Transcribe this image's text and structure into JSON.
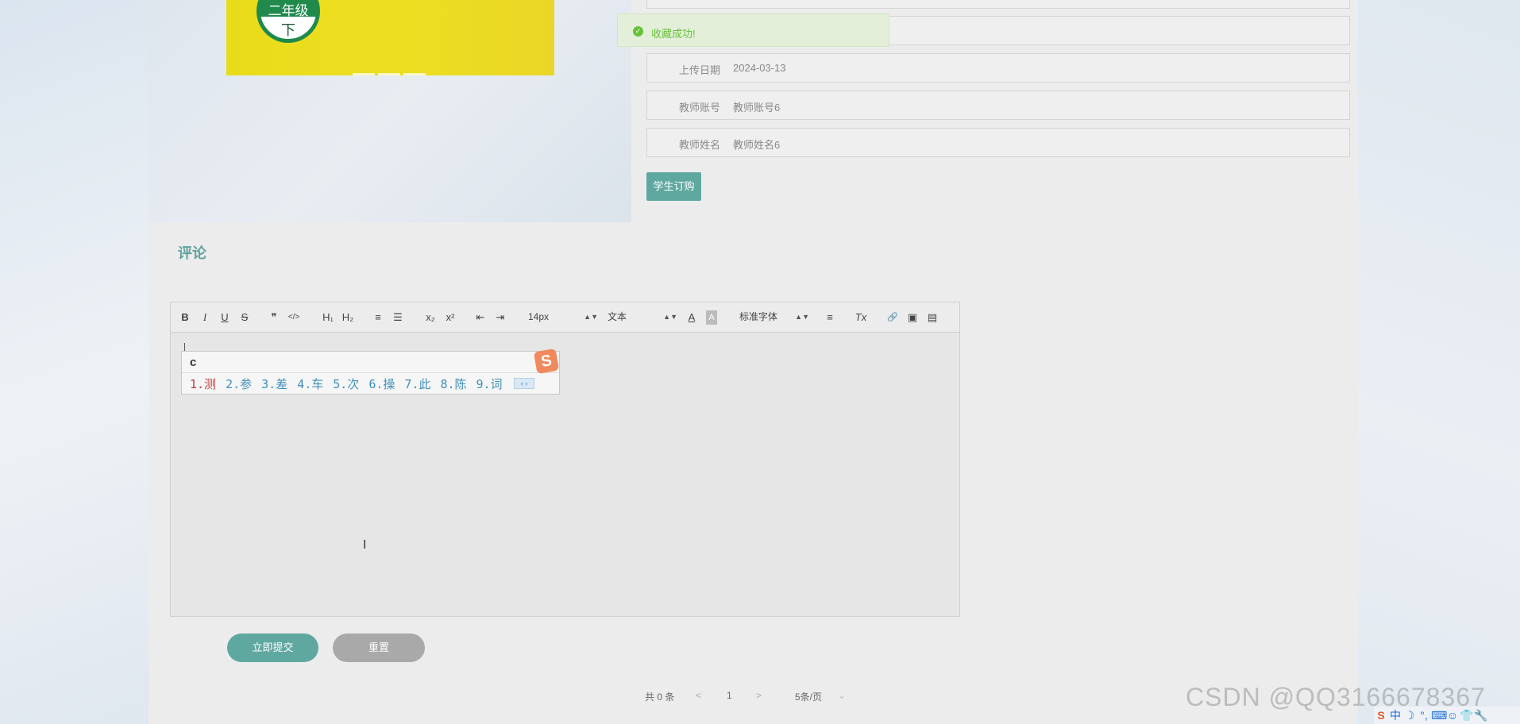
{
  "book": {
    "badge_top": "二年级",
    "badge_bottom": "下"
  },
  "toast": {
    "message": "收藏成功!"
  },
  "info": [
    {
      "label": "",
      "value": ""
    },
    {
      "label": "上传日期",
      "value": "2024-03-13"
    },
    {
      "label": "教师账号",
      "value": "教师账号6"
    },
    {
      "label": "教师姓名",
      "value": "教师姓名6"
    }
  ],
  "order_button": "学生订购",
  "comment": {
    "title": "评论",
    "toolbar": {
      "bold": "B",
      "italic": "I",
      "underline": "U",
      "strike": "S",
      "quote": "❞",
      "code": "</>",
      "h1": "H₁",
      "h2": "H₂",
      "ordered_list": "≡",
      "bullet_list": "☰",
      "sub": "x₂",
      "sup": "x²",
      "outdent": "⇤",
      "indent": "⇥",
      "size": "14px",
      "block": "文本",
      "font_color": "A",
      "bg_color": "A",
      "font": "标准字体",
      "align": "≡",
      "clean": "Tx",
      "link": "🔗",
      "image": "▣",
      "video": "▤"
    },
    "ime": {
      "composition": "c",
      "candidates": [
        "1.测",
        "2.参",
        "3.差",
        "4.车",
        "5.次",
        "6.操",
        "7.此",
        "8.陈",
        "9.词"
      ],
      "pager": "‹ ›",
      "logo": "S"
    },
    "submit": "立即提交",
    "reset": "重置"
  },
  "pagination": {
    "total": "共 0 条",
    "prev": "<",
    "page": "1",
    "next": ">",
    "page_size": "5条/页",
    "size_arrow": "⌄"
  },
  "watermark": "CSDN @QQ3166678367",
  "tray": {
    "ime_logo": "S",
    "lang": "中",
    "moon": "☽",
    "punct": "°,",
    "keyboard": "⌨",
    "user": "☺",
    "shirt": "👕",
    "tool": "🔧"
  },
  "colors": {
    "accent": "#5fa8a0",
    "toast_bg": "#e3efd9",
    "toast_text": "#67c23a",
    "reset": "#a9a9a9"
  }
}
